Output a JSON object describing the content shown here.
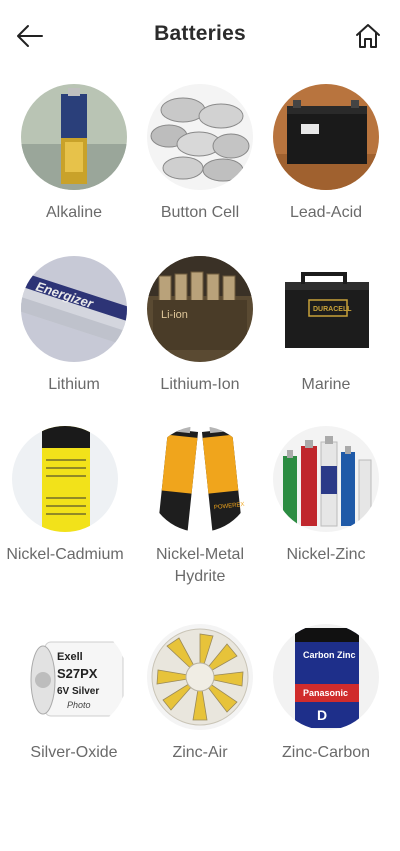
{
  "header": {
    "title": "Batteries",
    "back_icon": "arrow-left-icon",
    "home_icon": "home-icon"
  },
  "items": [
    {
      "label": "Alkaline",
      "icon": "alkaline-battery-photo"
    },
    {
      "label": "Button Cell",
      "icon": "button-cell-battery-photo"
    },
    {
      "label": "Lead-Acid",
      "icon": "lead-acid-battery-photo"
    },
    {
      "label": "Lithium",
      "icon": "lithium-battery-photo"
    },
    {
      "label": "Lithium-Ion",
      "icon": "lithium-ion-battery-photo"
    },
    {
      "label": "Marine",
      "icon": "marine-battery-photo"
    },
    {
      "label": "Nickel-Cadmium",
      "icon": "nickel-cadmium-battery-photo"
    },
    {
      "label": "Nickel-Metal Hydrite",
      "icon": "nickel-metal-hydride-battery-photo"
    },
    {
      "label": "Nickel-Zinc",
      "icon": "nickel-zinc-battery-photo"
    },
    {
      "label": "Silver-Oxide",
      "icon": "silver-oxide-battery-photo"
    },
    {
      "label": "Zinc-Air",
      "icon": "zinc-air-battery-photo"
    },
    {
      "label": "Zinc-Carbon",
      "icon": "zinc-carbon-battery-photo"
    }
  ],
  "photo_text": {
    "lithium": "Energizer",
    "lithium_ion": "Li-ion",
    "marine": "DURACELL",
    "silver_oxide_brand": "Exell",
    "silver_oxide_model": "S27PX",
    "silver_oxide_spec": "6V Silver",
    "silver_oxide_sub": "Photo",
    "zinc_carbon_brand": "Panasonic",
    "zinc_carbon_type": "Carbon Zinc",
    "zinc_carbon_size": "D",
    "nimh_brand": "POWEREX"
  },
  "colors": {
    "accent": "#2b2b2b",
    "label": "#6a6a6a",
    "background": "#ffffff"
  }
}
